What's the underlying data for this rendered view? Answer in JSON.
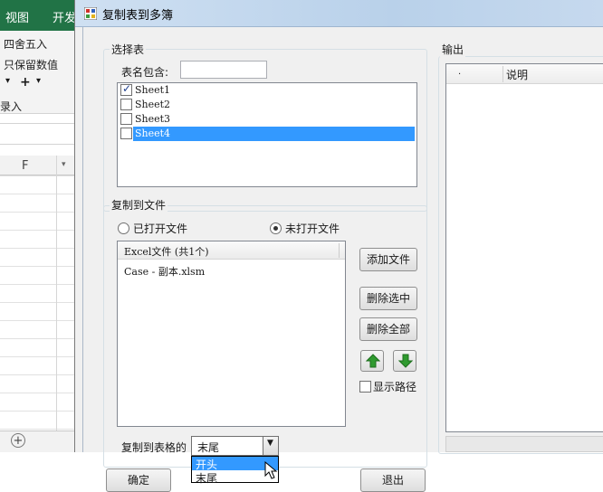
{
  "excel": {
    "tabs": [
      "视图",
      "开发"
    ],
    "ribbon_items": [
      "四舍五入",
      "只保留数值",
      "录入"
    ],
    "column_header": "F"
  },
  "dialog": {
    "title": "复制表到多簿",
    "select_sheet": {
      "group_label": "选择表",
      "filter_label": "表名包含:",
      "filter_value": "",
      "sheets": [
        {
          "name": "Sheet1",
          "checked": true,
          "selected": false
        },
        {
          "name": "Sheet2",
          "checked": false,
          "selected": false
        },
        {
          "name": "Sheet3",
          "checked": false,
          "selected": false
        },
        {
          "name": "Sheet4",
          "checked": false,
          "selected": true
        }
      ]
    },
    "copy_to_file": {
      "group_label": "复制到文件",
      "radio_opened": "已打开文件",
      "radio_unopened": "未打开文件",
      "selected_radio": "未打开文件",
      "list_header": "Excel文件 (共1个)",
      "files": [
        "Case - 副本.xlsm"
      ],
      "btn_add": "添加文件",
      "btn_delete_selected": "删除选中",
      "btn_delete_all": "删除全部",
      "show_path_label": "显示路径",
      "show_path_checked": false,
      "position_label": "复制到表格的",
      "position_value": "末尾",
      "position_options": [
        "开头",
        "末尾"
      ],
      "highlighted_option": "开头"
    },
    "output": {
      "group_label": "输出",
      "columns": [
        ".",
        "说明"
      ]
    },
    "btn_ok": "确定",
    "btn_exit": "退出"
  }
}
